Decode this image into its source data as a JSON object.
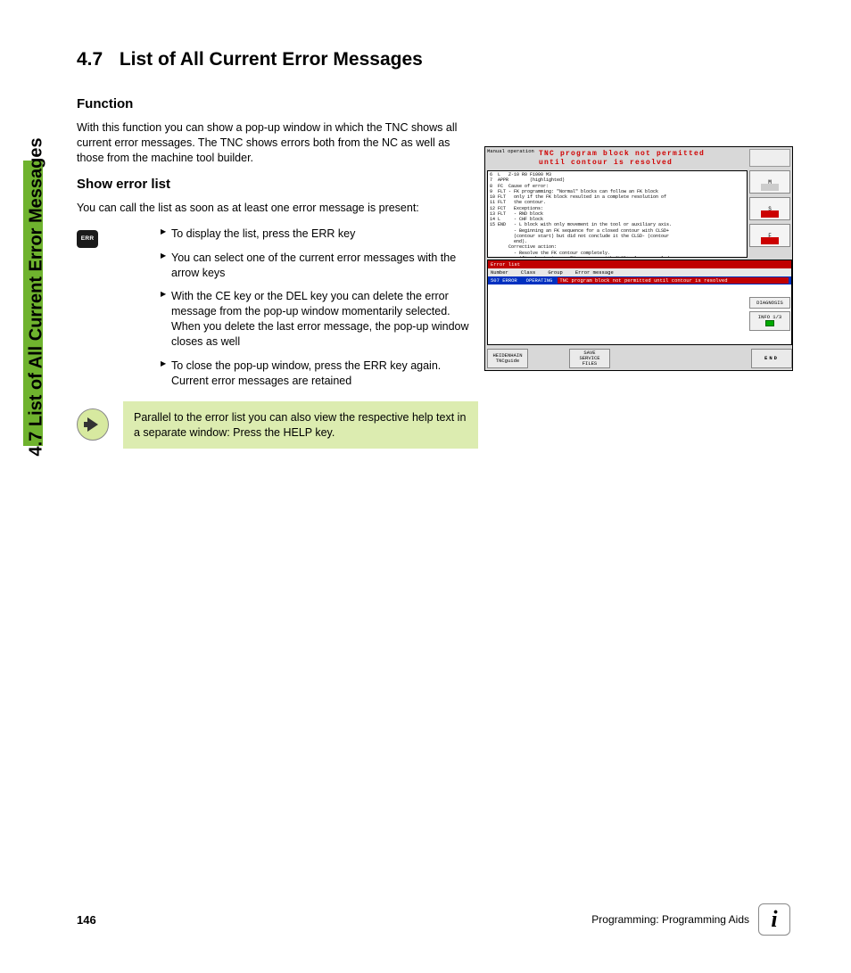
{
  "sideTab": "4.7 List of All Current Error Messages",
  "heading": {
    "number": "4.7",
    "text": "List of All Current Error Messages"
  },
  "sub1": "Function",
  "para1": "With this function you can show a pop-up window in which the TNC shows all current error messages. The TNC shows errors both from the NC as well as those from the machine tool builder.",
  "sub2": "Show error list",
  "para2": "You can call the list as soon as at least one error message is present:",
  "errKeyLabel": "ERR",
  "bullets": [
    "To display the list, press the ERR key",
    "You can select one of the current error messages with the arrow keys",
    "With the CE key or the DEL key you can delete the error message from the pop-up window momentarily selected. When you delete the last error message, the pop-up window closes as well",
    "To close the pop-up window, press the ERR key again. Current error messages are retained"
  ],
  "note": "Parallel to the error list you can also view the respective help text in a separate window: Press the HELP key.",
  "figure": {
    "mode": "Manual\noperation",
    "banner": "TNC program block not permitted\nuntil contour is resolved",
    "progLines": "6  L   Z-10 R0 F1000 M3\n7  APPR        (highlighted)\n8  FC  Cause of error:\n9  FLT - FK programming: \"Normal\" blocks can follow an FK block\n10 FLT   only if the FK block resulted in a complete resolution of\n11 FLT   the contour.\n12 FCT   Exceptions:\n13 FLT   - RND block\n14 L     - CHF block\n15 END   - L block with only movement in the tool or auxiliary axis.\n         - Beginning an FK sequence for a closed contour with CLSD+\n         (contour start) but did not conclude it the CLSD- (contour\n         end).\n       Corrective action:\n         - Resolve the FK contour completely.\n         - After beginning an FK sequence with CLSD+ always conclude\n         it with CLSD-.",
    "errListTitle": "Error list",
    "errHeaders": [
      "Number",
      "Class",
      "Group",
      "Error message"
    ],
    "errRow": {
      "num": "507",
      "cls": "ERROR",
      "grp": "OPERATING",
      "msg": "TNC program block not permitted until contour is resolved"
    },
    "sideBtns": [
      "M",
      "S",
      "F"
    ],
    "diagBtn1": "DIAGNOSIS",
    "diagBtn2": "INFO 1/3",
    "softkeys": {
      "sk1a": "HEIDENHAIN",
      "sk1b": "TNCguide",
      "sk2": "SAVE\nSERVICE\nFILES",
      "end": "END"
    }
  },
  "footer": {
    "pageNum": "146",
    "chapter": "Programming: Programming Aids",
    "info": "i"
  }
}
